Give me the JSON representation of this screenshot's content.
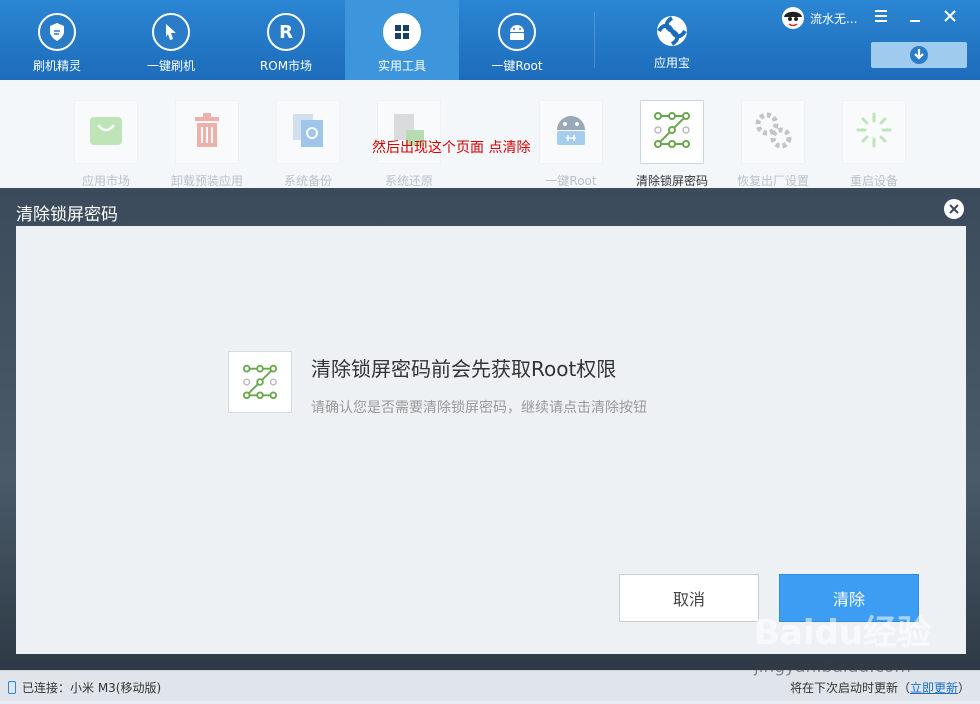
{
  "nav": {
    "items": [
      {
        "label": "刷机精灵",
        "icon": "shield-icon"
      },
      {
        "label": "一键刷机",
        "icon": "cursor-icon"
      },
      {
        "label": "ROM市场",
        "icon": "rom-r-icon"
      },
      {
        "label": "实用工具",
        "icon": "grid-icon",
        "active": true
      },
      {
        "label": "一键Root",
        "icon": "android-icon"
      },
      {
        "label": "应用宝",
        "icon": "yingyongbao-icon"
      }
    ],
    "user_name": "流水无...",
    "accent": "#1c6cba"
  },
  "tools": {
    "items": [
      {
        "label": "应用市场",
        "icon": "shopping-bag-icon"
      },
      {
        "label": "卸载预装应用",
        "icon": "trash-icon"
      },
      {
        "label": "系统备份",
        "icon": "backup-icon"
      },
      {
        "label": "系统还原",
        "icon": "restore-icon"
      },
      {
        "label": "一键Root",
        "icon": "android-icon"
      },
      {
        "label": "清除锁屏密码",
        "icon": "pattern-lock-icon",
        "active": true
      },
      {
        "label": "恢复出厂设置",
        "icon": "gears-icon"
      },
      {
        "label": "重启设备",
        "icon": "restart-spinner-icon"
      }
    ],
    "annotation": "然后出现这个页面  点清除"
  },
  "dialog": {
    "title": "清除锁屏密码",
    "message_title": "清除锁屏密码前会先获取Root权限",
    "message_sub": "请确认您是否需要清除锁屏密码，继续请点击清除按钮",
    "cancel_label": "取消",
    "clear_label": "清除",
    "clear_color": "#3c9df2"
  },
  "status": {
    "connected": "已连接：小米 M3(移动版)",
    "update_text": "将在下次启动时更新（",
    "update_link": "立即更新",
    "update_close": "）"
  },
  "watermark": {
    "brand": "Baidu经验",
    "url": "jingyan.baidu.com"
  }
}
